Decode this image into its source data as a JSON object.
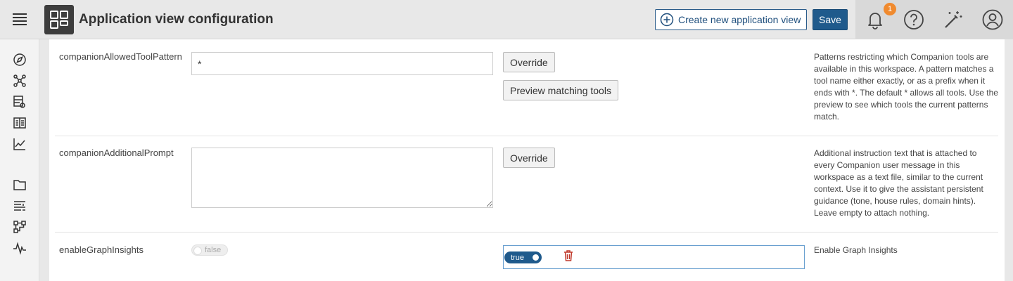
{
  "header": {
    "title": "Application view configuration",
    "create_label": "Create new application view",
    "save_label": "Save",
    "notification_count": "1"
  },
  "colors": {
    "accent": "#1f5a8c",
    "badge": "#f08a2e",
    "delete": "#c0392b"
  },
  "sidebar": {
    "icons": [
      "compass-icon",
      "graph-network-icon",
      "data-view-icon",
      "reader-icon",
      "line-chart-icon",
      "folder-icon",
      "list-filter-icon",
      "workflow-icon",
      "pulse-icon"
    ]
  },
  "rows": [
    {
      "key": "companionAllowedToolPattern",
      "value": "*",
      "override_label": "Override",
      "preview_label": "Preview matching tools",
      "description": "Patterns restricting which Companion tools are available in this workspace. A pattern matches a tool name either exactly, or as a prefix when it ends with *. The default * allows all tools. Use the preview to see which tools the current patterns match."
    },
    {
      "key": "companionAdditionalPrompt",
      "value": "",
      "override_label": "Override",
      "description": "Additional instruction text that is attached to every Companion user message in this workspace as a text file, similar to the current context. Use it to give the assistant persistent guidance (tone, house rules, domain hints). Leave empty to attach nothing."
    },
    {
      "key": "enableGraphInsights",
      "default_label": "false",
      "override_value_label": "true",
      "description": "Enable Graph Insights"
    }
  ]
}
